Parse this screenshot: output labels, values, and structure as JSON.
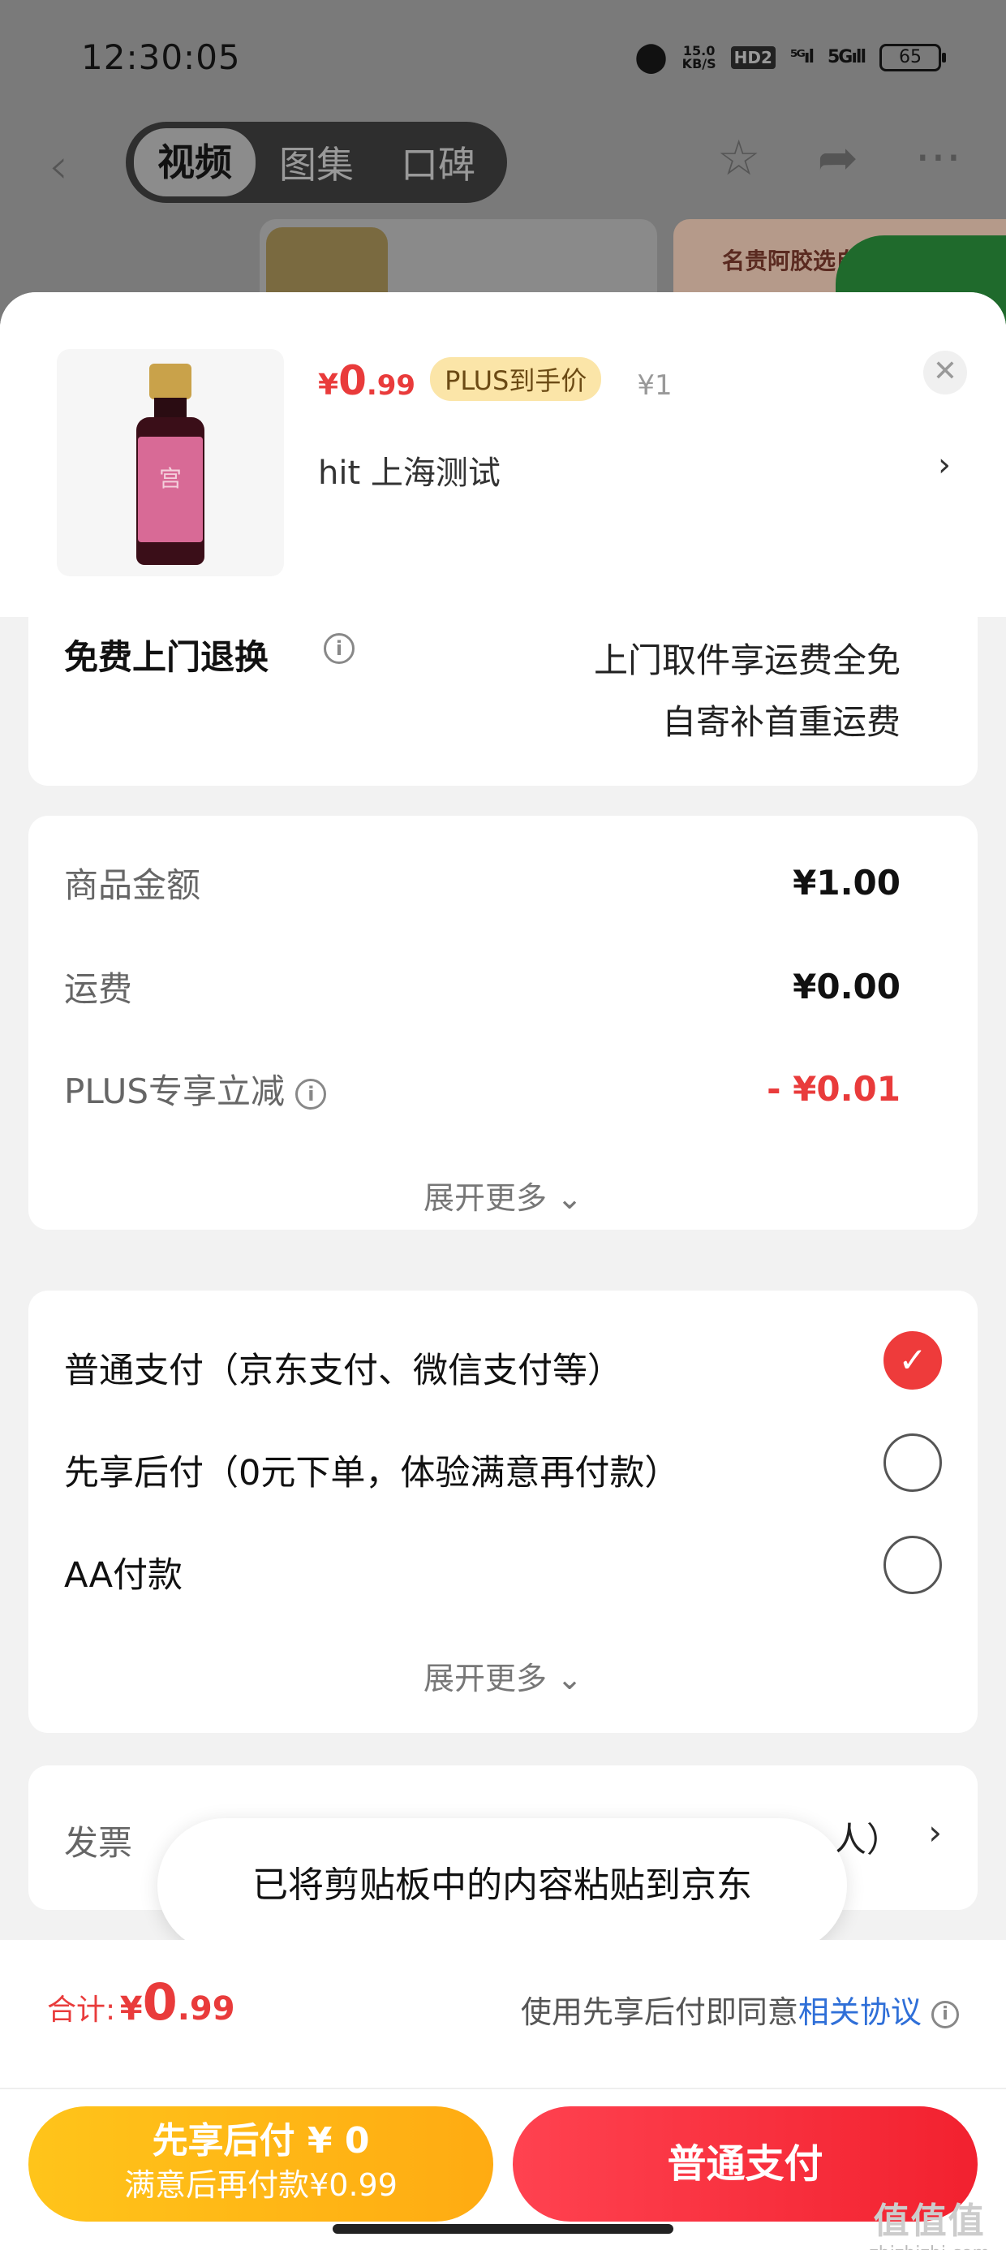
{
  "status_bar": {
    "time": "12:30:05",
    "net_speed": "15.0",
    "net_unit": "KB/S",
    "hd": "HD2",
    "signal1": "⁵ᴳıl",
    "signal2": "5Gıll",
    "battery": "65"
  },
  "background_nav": {
    "tabs": [
      "视频",
      "图集",
      "口碑"
    ],
    "active_tab": 0,
    "thumb_text": "名贵阿胶选自"
  },
  "product": {
    "price_symbol": "¥",
    "price_int": "0",
    "price_dec": ".99",
    "plus_badge": "PLUS到手价",
    "original_price": "¥1",
    "shop_text": "hit  上海测试"
  },
  "return_service": {
    "label": "免费上门退换",
    "line1": "上门取件享运费全免",
    "line2": "自寄补首重运费"
  },
  "amounts": {
    "rows": [
      {
        "label": "商品金额",
        "value": "¥1.00"
      },
      {
        "label": "运费",
        "value": "¥0.00"
      },
      {
        "label": "PLUS专享立减",
        "value": "- ¥0.01"
      }
    ],
    "expand": "展开更多"
  },
  "payment": {
    "options": [
      {
        "label": "普通支付（京东支付、微信支付等）",
        "selected": true
      },
      {
        "label": "先享后付（0元下单，体验满意再付款）",
        "selected": false
      },
      {
        "label": "AA付款",
        "selected": false
      }
    ],
    "expand": "展开更多"
  },
  "invoice": {
    "label": "发票",
    "value": "人）"
  },
  "toast": "已将剪贴板中的内容粘贴到京东",
  "footer": {
    "total_label": "合计:",
    "total_symbol": "¥",
    "total_int": "0",
    "total_dec": ".99",
    "agree_prefix": "使用先享后付即同意",
    "agree_link": "相关协议",
    "later_btn_line1": "先享后付 ¥ 0",
    "later_btn_line2": "满意后再付款¥0.99",
    "pay_btn": "普通支付"
  },
  "watermark": {
    "brand": "值值值",
    "site": "zhizhizhi.com"
  },
  "colors": {
    "accent_red": "#e93b3b",
    "gold": "#ffc41a",
    "link_blue": "#2f6fd8"
  }
}
